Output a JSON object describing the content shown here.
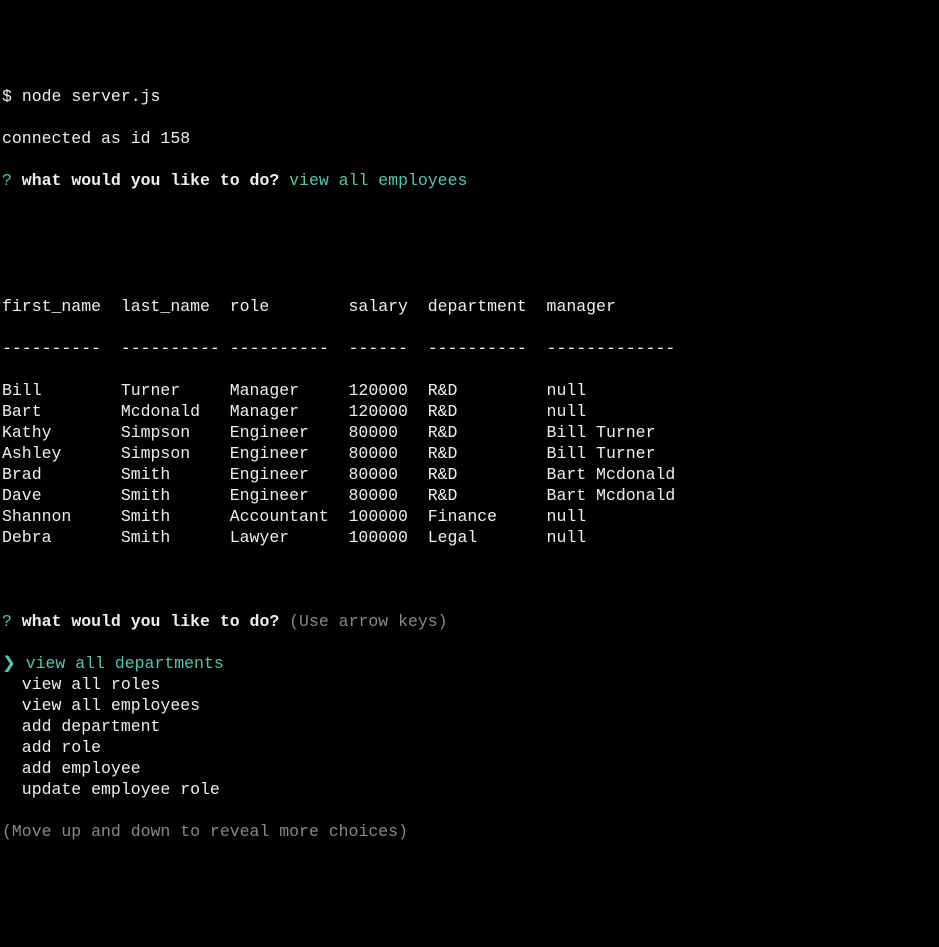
{
  "prompt_symbol": "$ ",
  "command": "node server.js",
  "status_line": "connected as id 158",
  "question_mark": "?",
  "question_text": " what would you like to do? ",
  "answer1": "view all employees",
  "table": {
    "headers": [
      "first_name",
      "last_name",
      "role",
      "salary",
      "department",
      "manager"
    ],
    "dividers": [
      "----------",
      "----------",
      "----------",
      "------",
      "----------",
      "-------------"
    ],
    "rows": [
      [
        "Bill",
        "Turner",
        "Manager",
        "120000",
        "R&D",
        "null"
      ],
      [
        "Bart",
        "Mcdonald",
        "Manager",
        "120000",
        "R&D",
        "null"
      ],
      [
        "Kathy",
        "Simpson",
        "Engineer",
        "80000",
        "R&D",
        "Bill Turner"
      ],
      [
        "Ashley",
        "Simpson",
        "Engineer",
        "80000",
        "R&D",
        "Bill Turner"
      ],
      [
        "Brad",
        "Smith",
        "Engineer",
        "80000",
        "R&D",
        "Bart Mcdonald"
      ],
      [
        "Dave",
        "Smith",
        "Engineer",
        "80000",
        "R&D",
        "Bart Mcdonald"
      ],
      [
        "Shannon",
        "Smith",
        "Accountant",
        "100000",
        "Finance",
        "null"
      ],
      [
        "Debra",
        "Smith",
        "Lawyer",
        "100000",
        "Legal",
        "null"
      ]
    ]
  },
  "question2_hint": "(Use arrow keys)",
  "pointer": "❯ ",
  "menu": [
    "view all departments",
    "view all roles",
    "view all employees",
    "add department",
    "add role",
    "add employee",
    "update employee role"
  ],
  "footer": "(Move up and down to reveal more choices)",
  "chart_data": {
    "type": "table",
    "columns": [
      "first_name",
      "last_name",
      "role",
      "salary",
      "department",
      "manager"
    ],
    "rows": [
      [
        "Bill",
        "Turner",
        "Manager",
        120000,
        "R&D",
        null
      ],
      [
        "Bart",
        "Mcdonald",
        "Manager",
        120000,
        "R&D",
        null
      ],
      [
        "Kathy",
        "Simpson",
        "Engineer",
        80000,
        "R&D",
        "Bill Turner"
      ],
      [
        "Ashley",
        "Simpson",
        "Engineer",
        80000,
        "R&D",
        "Bill Turner"
      ],
      [
        "Brad",
        "Smith",
        "Engineer",
        80000,
        "R&D",
        "Bart Mcdonald"
      ],
      [
        "Dave",
        "Smith",
        "Engineer",
        80000,
        "R&D",
        "Bart Mcdonald"
      ],
      [
        "Shannon",
        "Smith",
        "Accountant",
        100000,
        "Finance",
        null
      ],
      [
        "Debra",
        "Smith",
        "Lawyer",
        100000,
        "Legal",
        null
      ]
    ]
  }
}
